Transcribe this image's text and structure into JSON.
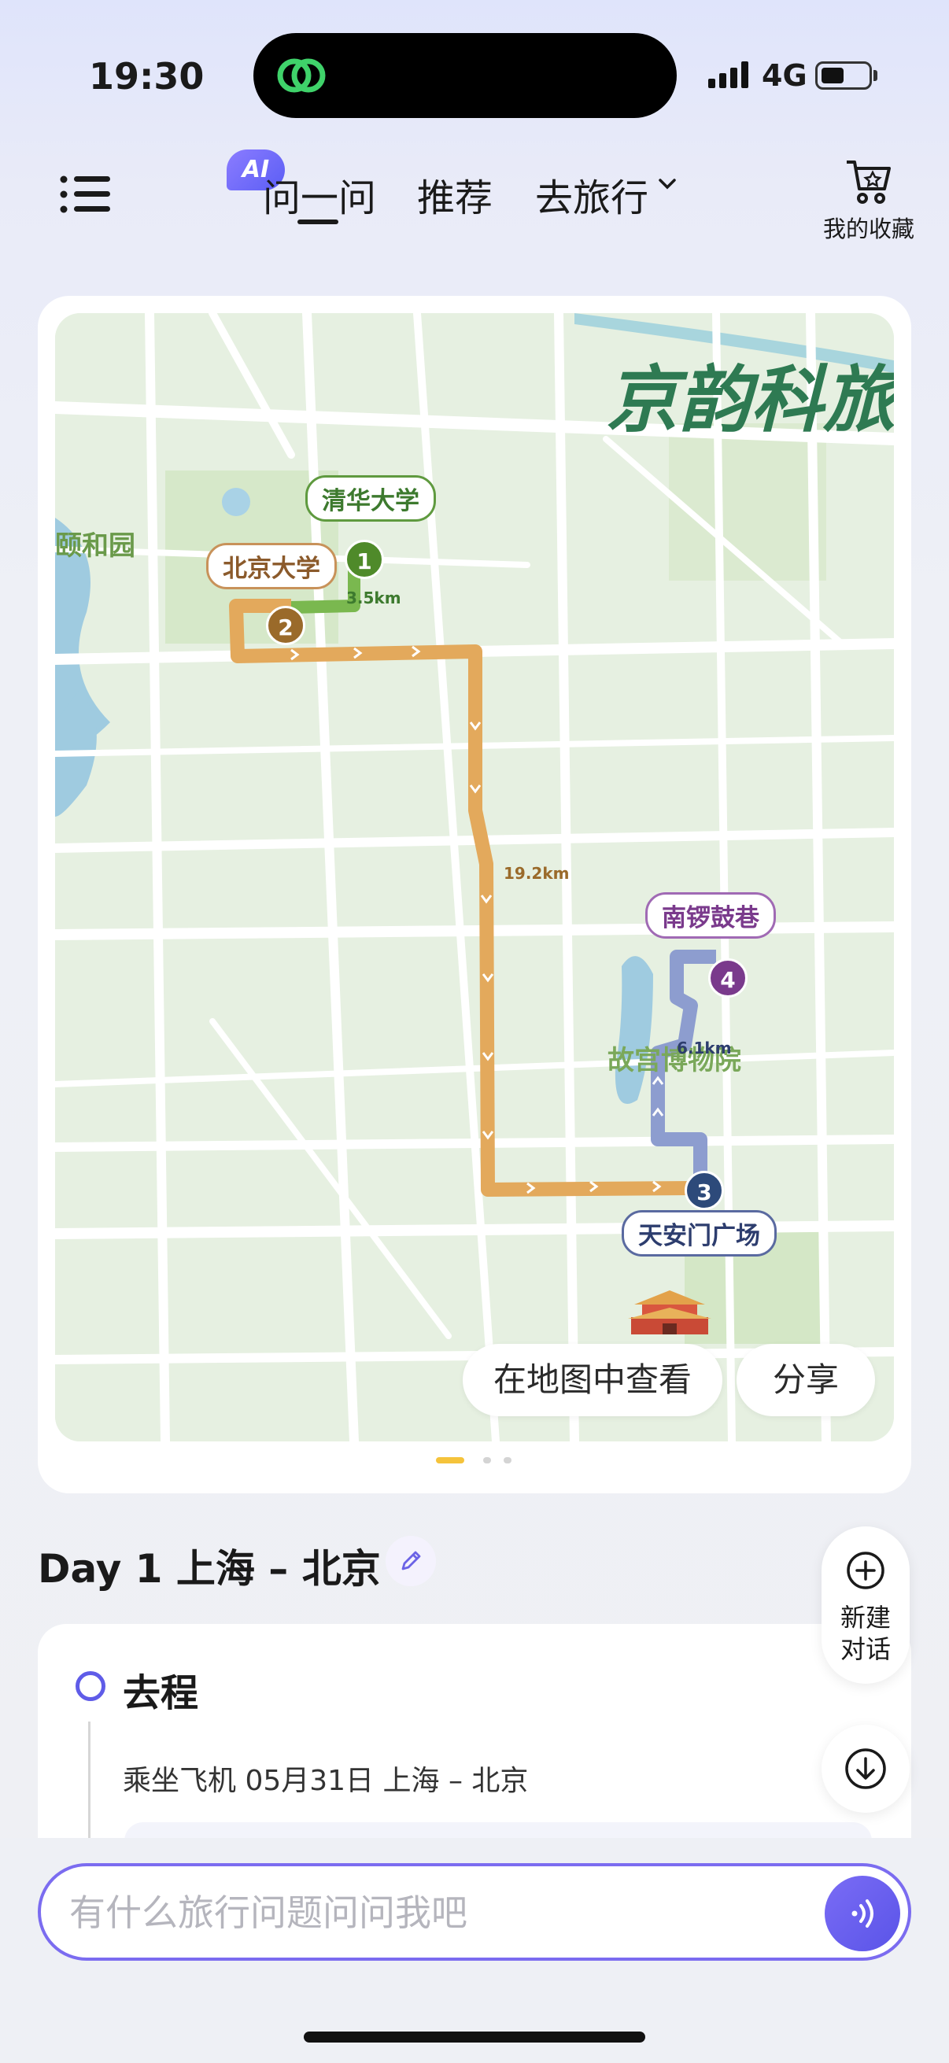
{
  "status_bar": {
    "time": "19:30",
    "network": "4G"
  },
  "header": {
    "ai_badge": "AI",
    "tabs": [
      {
        "label": "问一问",
        "active": true
      },
      {
        "label": "推荐",
        "active": false
      },
      {
        "label": "去旅行",
        "active": false
      }
    ],
    "favorites_label": "我的收藏"
  },
  "map": {
    "brand": "京韵科旅",
    "area_labels": {
      "park": "颐和园",
      "museum": "故宫博物院"
    },
    "stops": [
      {
        "number": "1",
        "name": "清华大学",
        "color": "#4f8a2a"
      },
      {
        "number": "2",
        "name": "北京大学",
        "color": "#9a6a2a"
      },
      {
        "number": "3",
        "name": "天安门广场",
        "color": "#2d4a7a"
      },
      {
        "number": "4",
        "name": "南锣鼓巷",
        "color": "#7a3a8c"
      }
    ],
    "segments": [
      {
        "distance": "3.5km",
        "color": "#6aa84f"
      },
      {
        "distance": "19.2km",
        "color": "#e3a95c"
      },
      {
        "distance": "6.1km",
        "color": "#8192c4"
      }
    ],
    "view_in_map_button": "在地图中查看",
    "share_button": "分享",
    "carousel": {
      "pages": 3,
      "current": 1
    }
  },
  "day": {
    "title": "Day 1 上海 – 北京"
  },
  "itinerary": {
    "section_title": "去程",
    "detail": "乘坐飞机 05月31日 上海 – 北京"
  },
  "fab": {
    "new_chat_label_line1": "新建",
    "new_chat_label_line2": "对话"
  },
  "input": {
    "placeholder": "有什么旅行问题问问我吧"
  },
  "colors": {
    "accent": "#5f5ce8",
    "brand_green": "#2e7a52",
    "route_orange": "#e3a95c"
  }
}
